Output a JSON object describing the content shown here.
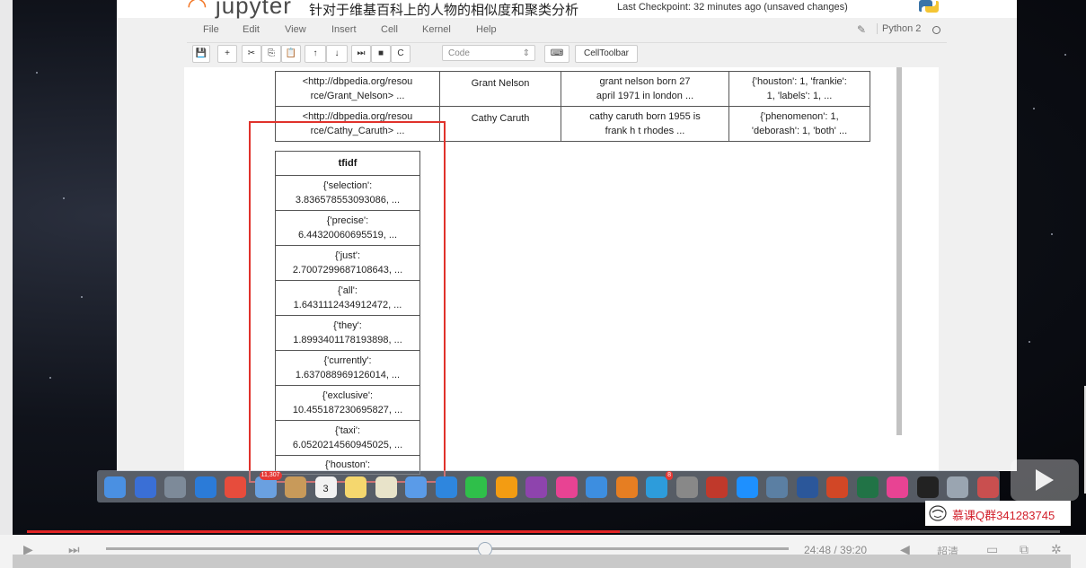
{
  "jupyter": {
    "logo_text": "jupyter",
    "notebook_title": "针对于维基百科上的人物的相似度和聚类分析",
    "checkpoint": "Last Checkpoint: 32 minutes ago (unsaved changes)",
    "menu": [
      "File",
      "Edit",
      "View",
      "Insert",
      "Cell",
      "Kernel",
      "Help"
    ],
    "kernel_name": "Python 2",
    "toolbar": {
      "save": "💾",
      "add": "+",
      "cut": "✂",
      "copy": "⎘",
      "paste": "📋",
      "up": "↑",
      "down": "↓",
      "run": "⏭",
      "stop": "■",
      "restart": "C",
      "cell_type": "Code",
      "keyboard": "⌨",
      "celltoolbar": "CellToolbar"
    }
  },
  "people_table": {
    "rows": [
      {
        "uri": "<http://dbpedia.org/resource/Grant_Nelson> ...",
        "uri_l1": "<http://dbpedia.org/resou",
        "uri_l2": "rce/Grant_Nelson> ...",
        "name": "Grant Nelson",
        "text_l1": "grant nelson born 27",
        "text_l2": "april 1971 in london ...",
        "wc_l1": "{'houston': 1, 'frankie':",
        "wc_l2": "1, 'labels': 1, ..."
      },
      {
        "uri": "<http://dbpedia.org/resource/Cathy_Caruth> ...",
        "uri_l1": "<http://dbpedia.org/resou",
        "uri_l2": "rce/Cathy_Caruth> ...",
        "name": "Cathy Caruth",
        "text_l1": "cathy caruth born 1955 is",
        "text_l2": "frank h t rhodes ...",
        "wc_l1": "{'phenomenon': 1,",
        "wc_l2": "'deborash': 1, 'both' ..."
      }
    ]
  },
  "tfidf_table": {
    "header": "tfidf",
    "rows": [
      {
        "k": "{'selection':",
        "v": "3.836578553093086, ..."
      },
      {
        "k": "{'precise':",
        "v": "6.44320060695519, ..."
      },
      {
        "k": "{'just':",
        "v": "2.7007299687108643, ..."
      },
      {
        "k": "{'all':",
        "v": "1.6431112434912472, ..."
      },
      {
        "k": "{'they':",
        "v": "1.8993401178193898, ..."
      },
      {
        "k": "{'currently':",
        "v": "1.637088969126014, ..."
      },
      {
        "k": "{'exclusive':",
        "v": "10.455187230695827, ..."
      },
      {
        "k": "{'taxi':",
        "v": "6.0520214560945025, ..."
      },
      {
        "k": "{'houston':",
        "v": ""
      }
    ]
  },
  "dock": {
    "icon_colors": [
      "#4a90e2",
      "#3a6fd6",
      "#7d8a99",
      "#2b7bd8",
      "#e74c3c",
      "#6aa0e0",
      "#c89a5a",
      "#f2f2f2",
      "#f5d76e",
      "#e8e3c9",
      "#5a9be8",
      "#2e86de",
      "#2fbf4a",
      "#f39c12",
      "#8e44ad",
      "#e84393",
      "#3d8ee0",
      "#e67e22",
      "#2d9cdb",
      "#888888",
      "#c0392b",
      "#1e90ff",
      "#5b7fa3",
      "#2b579a",
      "#d24726",
      "#217346",
      "#e84393",
      "#222222",
      "#9aa5b1",
      "#c94f4f"
    ],
    "calendar_day": "3",
    "badge": "11,307",
    "badge2": "8"
  },
  "watermark": {
    "text": "慕课Q群341283745"
  },
  "player": {
    "progress_fraction": 0.574,
    "quality_label": "超清",
    "timecode": "24:48 / 39:20"
  },
  "colors": {
    "highlight_box": "#e0322b",
    "progress": "#e02424",
    "watermark_text": "#d2202b"
  }
}
